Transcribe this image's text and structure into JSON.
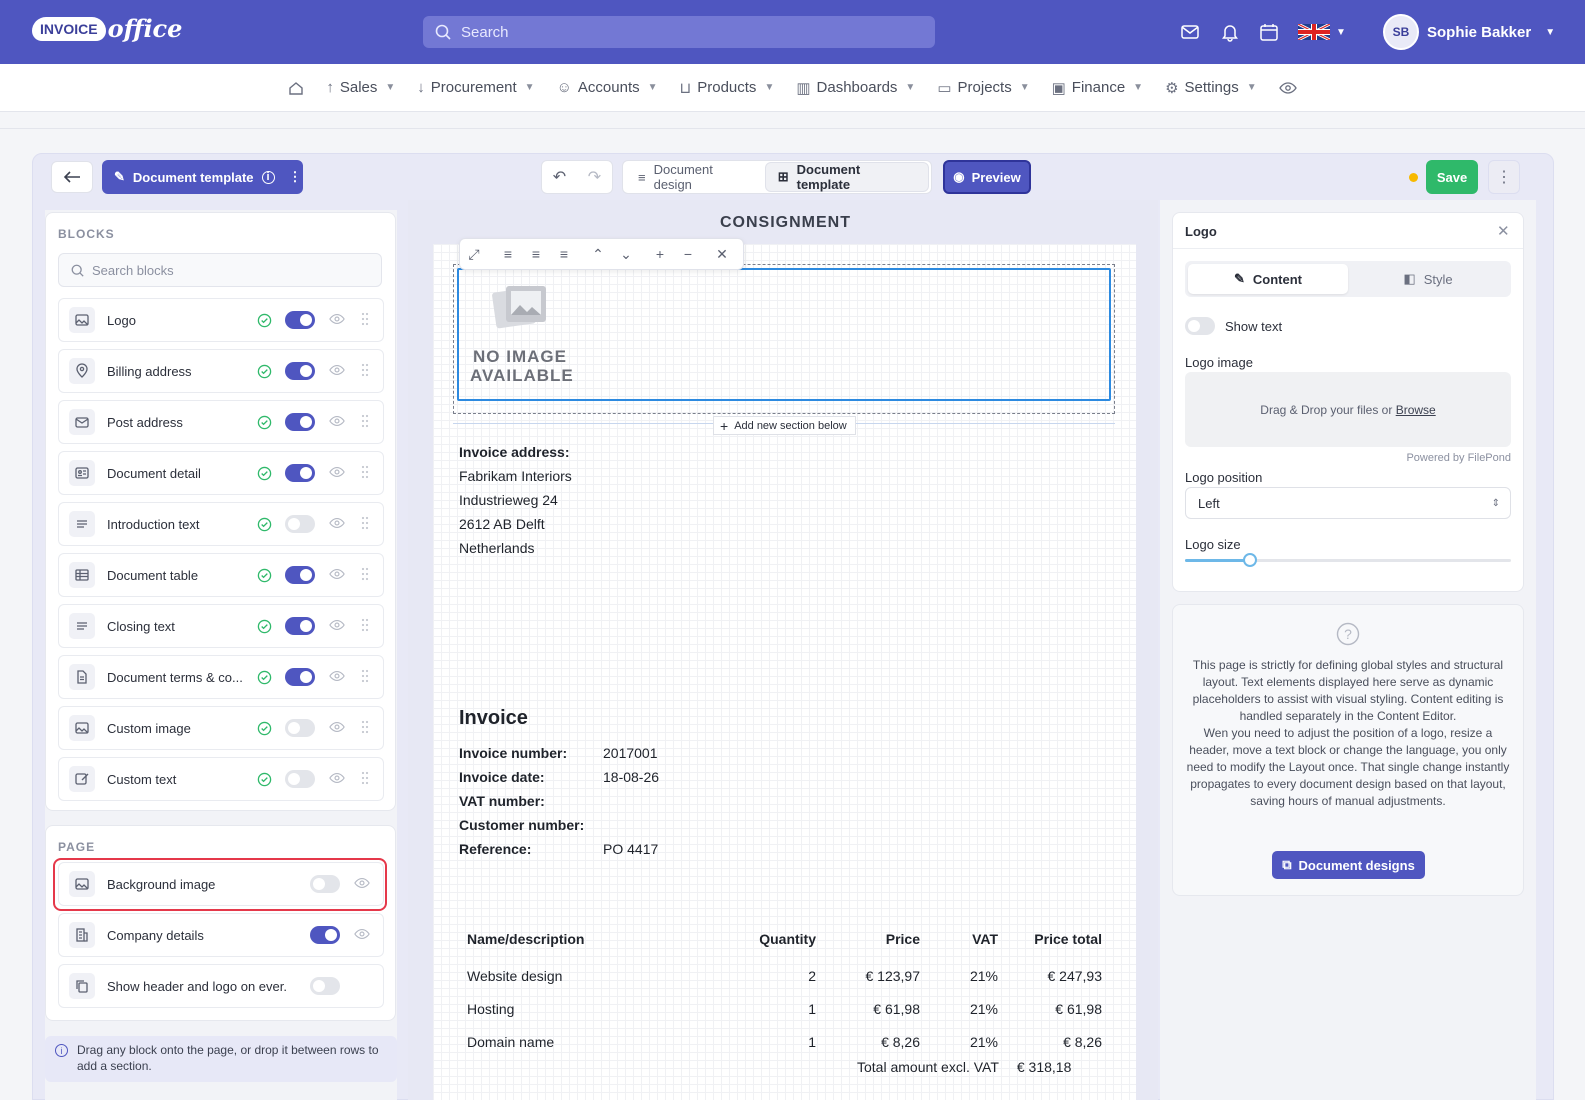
{
  "brand": {
    "logo_word1": "INVOICE",
    "logo_word2": "office",
    "primary_color": "#4f56c0",
    "success_color": "#2fb96a"
  },
  "header": {
    "search_placeholder": "Search",
    "user_initials": "SB",
    "user_name": "Sophie Bakker",
    "icons": [
      "mail-icon",
      "bell-icon",
      "calendar-icon",
      "uk-flag-icon"
    ]
  },
  "nav": {
    "items": [
      "Sales",
      "Procurement",
      "Accounts",
      "Products",
      "Dashboards",
      "Projects",
      "Finance",
      "Settings"
    ]
  },
  "toolbar": {
    "doc_template_label": "Document template",
    "tab_design": "Document design",
    "tab_template": "Document template",
    "preview_label": "Preview",
    "save_label": "Save"
  },
  "blocks": {
    "title": "BLOCKS",
    "search_placeholder": "Search blocks",
    "items": [
      {
        "label": "Logo",
        "icon": "image-icon",
        "enabled": true
      },
      {
        "label": "Billing address",
        "icon": "map-pin-icon",
        "enabled": true
      },
      {
        "label": "Post address",
        "icon": "mail-icon",
        "enabled": true
      },
      {
        "label": "Document detail",
        "icon": "id-card-icon",
        "enabled": true
      },
      {
        "label": "Introduction text",
        "icon": "text-lines-icon",
        "enabled": false
      },
      {
        "label": "Document table",
        "icon": "table-icon",
        "enabled": true
      },
      {
        "label": "Closing text",
        "icon": "text-lines-icon",
        "enabled": true
      },
      {
        "label": "Document terms & co...",
        "icon": "file-icon",
        "enabled": true
      },
      {
        "label": "Custom image",
        "icon": "image-icon",
        "enabled": false
      },
      {
        "label": "Custom text",
        "icon": "edit-icon",
        "enabled": false
      }
    ]
  },
  "page_section": {
    "title": "PAGE",
    "items": [
      {
        "label": "Background image",
        "enabled": false
      },
      {
        "label": "Company details",
        "enabled": true
      },
      {
        "label": "Show header and logo on ever...",
        "enabled": false
      }
    ]
  },
  "hint": "Drag any block onto the page, or drop it between rows to add a section.",
  "document": {
    "title": "CONSIGNMENT",
    "no_image_line1": "NO IMAGE",
    "no_image_line2": "AVAILABLE",
    "add_section": "Add new section below",
    "address_label": "Invoice address:",
    "address_lines": [
      "Fabrikam Interiors",
      "Industrieweg 24",
      "2612 AB Delft",
      "Netherlands"
    ],
    "invoice_heading": "Invoice",
    "details": [
      {
        "k": "Invoice number:",
        "v": "2017001"
      },
      {
        "k": "Invoice date:",
        "v": "18-08-26"
      },
      {
        "k": "VAT number:",
        "v": ""
      },
      {
        "k": "Customer number:",
        "v": ""
      },
      {
        "k": "Reference:",
        "v": "PO 4417"
      }
    ],
    "table": {
      "headers": [
        "Name/description",
        "Quantity",
        "Price",
        "VAT",
        "Price total"
      ],
      "rows": [
        [
          "Website design",
          "2",
          "€ 123,97",
          "21%",
          "€ 247,93"
        ],
        [
          "Hosting",
          "1",
          "€ 61,98",
          "21%",
          "€ 61,98"
        ],
        [
          "Domain name",
          "1",
          "€ 8,26",
          "21%",
          "€ 8,26"
        ]
      ],
      "total_label": "Total amount excl. VAT",
      "total_value": "€ 318,18"
    }
  },
  "props": {
    "title": "Logo",
    "tab_content": "Content",
    "tab_style": "Style",
    "show_text": "Show text",
    "logo_image": "Logo image",
    "drop_text": "Drag & Drop your files or",
    "browse": "Browse",
    "powered": "Powered by FilePond",
    "logo_position": "Logo position",
    "position_value": "Left",
    "logo_size": "Logo size",
    "logo_size_fraction": 0.2
  },
  "info": {
    "text1": "This page is strictly for defining global styles and structural layout. Text elements displayed here serve as dynamic placeholders to assist with visual styling. Content editing is handled separately in the Content Editor.",
    "text2": "Wen you need to adjust the position of a logo, resize a header, move a text block or change the language, you only need to modify the Layout once. That single change instantly propagates to every document design based on that layout, saving hours of manual adjustments.",
    "button": "Document designs"
  }
}
